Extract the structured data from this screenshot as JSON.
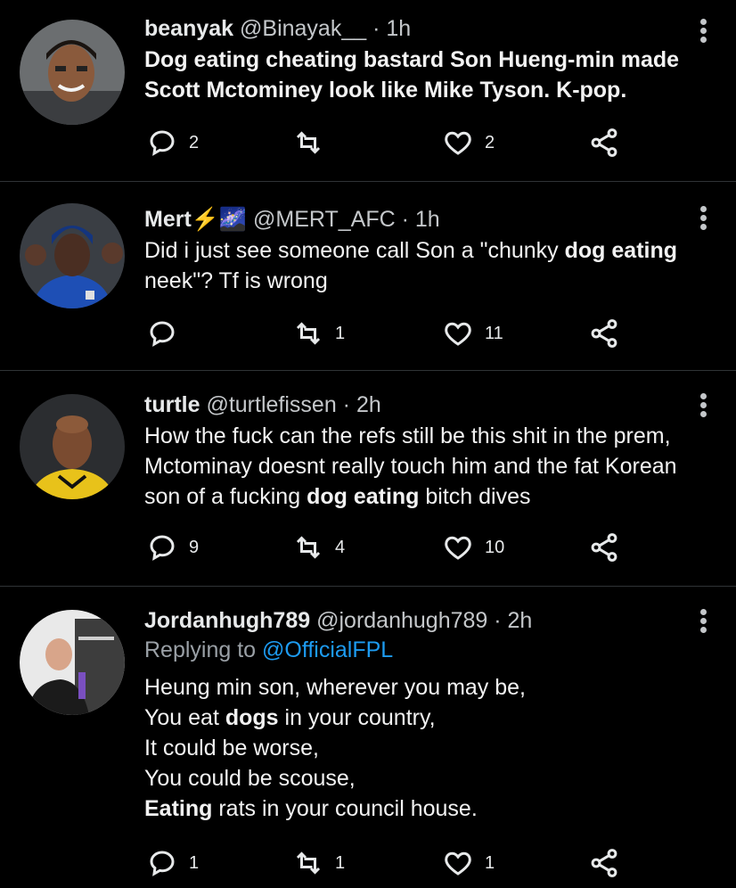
{
  "tweets": [
    {
      "name": "beanyak",
      "name_suffix": "",
      "handle": "@Binayak__",
      "time": "1h",
      "replying_to": "",
      "lines": [
        [
          {
            "t": "Dog eating cheating bastard Son Hueng-min made",
            "b": false
          }
        ],
        [
          {
            "t": "Scott Mctominey look like Mike Tyson. K-pop.",
            "b": false
          }
        ]
      ],
      "replies": "2",
      "retweets": "",
      "likes": "2"
    },
    {
      "name": "Mert",
      "name_suffix": "⚡🌌",
      "handle": "@MERT_AFC",
      "time": "1h",
      "replying_to": "",
      "lines": [
        [
          {
            "t": "Did i just see someone call Son a \"chunky ",
            "b": false
          },
          {
            "t": "dog eating",
            "b": true
          }
        ],
        [
          {
            "t": "neek\"? Tf is wrong",
            "b": false
          }
        ]
      ],
      "replies": "",
      "retweets": "1",
      "likes": "11"
    },
    {
      "name": "turtle",
      "name_suffix": "",
      "handle": "@turtlefissen",
      "time": "2h",
      "replying_to": "",
      "lines": [
        [
          {
            "t": "How the fuck can the refs still be this shit in the prem,",
            "b": false
          }
        ],
        [
          {
            "t": "Mctominay doesnt really touch him and the fat Korean",
            "b": false
          }
        ],
        [
          {
            "t": "son of a fucking ",
            "b": false
          },
          {
            "t": "dog eating",
            "b": true
          },
          {
            "t": " bitch dives",
            "b": false
          }
        ]
      ],
      "replies": "9",
      "retweets": "4",
      "likes": "10"
    },
    {
      "name": "Jordanhugh789",
      "name_suffix": "",
      "handle": "@jordanhugh789",
      "time": "2h",
      "replying_prefix": "Replying to ",
      "replying_to": "@OfficialFPL",
      "lines": [
        [
          {
            "t": "Heung min son, wherever you may be,",
            "b": false
          }
        ],
        [
          {
            "t": "You eat ",
            "b": false
          },
          {
            "t": "dogs",
            "b": true
          },
          {
            "t": " in your country,",
            "b": false
          }
        ],
        [
          {
            "t": "It could be worse,",
            "b": false
          }
        ],
        [
          {
            "t": "You could be scouse,",
            "b": false
          }
        ],
        [
          {
            "t": "Eating",
            "b": true
          },
          {
            "t": " rats in your council house.",
            "b": false
          }
        ]
      ],
      "replies": "1",
      "retweets": "1",
      "likes": "1"
    }
  ],
  "separator": " · ",
  "colors": {
    "background": "#000000",
    "text": "#e7e9ea",
    "link": "#1d9bf0",
    "divider": "#2f3336"
  },
  "icons": [
    "reply-icon",
    "retweet-icon",
    "like-icon",
    "share-icon",
    "more-icon"
  ]
}
